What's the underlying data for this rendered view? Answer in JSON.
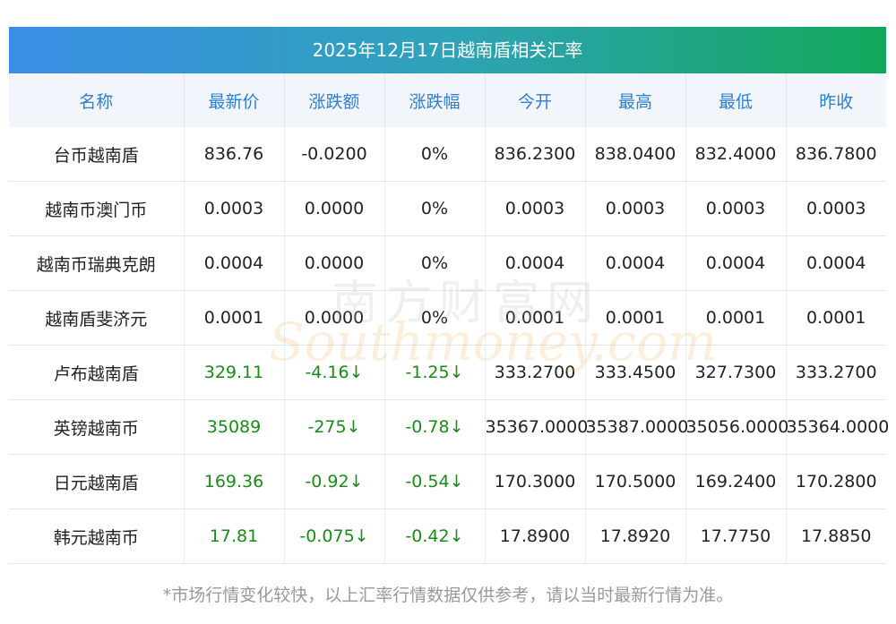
{
  "title": "2025年12月17日越南盾相关汇率",
  "columns": [
    "名称",
    "最新价",
    "涨跌额",
    "涨跌幅",
    "今开",
    "最高",
    "最低",
    "昨收"
  ],
  "rows": [
    {
      "name": "台币越南盾",
      "latest": "836.76",
      "change": "-0.0200",
      "pct": "0%",
      "open": "836.2300",
      "high": "838.0400",
      "low": "832.4000",
      "prev": "836.7800",
      "trend": "flat"
    },
    {
      "name": "越南币澳门币",
      "latest": "0.0003",
      "change": "0.0000",
      "pct": "0%",
      "open": "0.0003",
      "high": "0.0003",
      "low": "0.0003",
      "prev": "0.0003",
      "trend": "flat"
    },
    {
      "name": "越南币瑞典克朗",
      "latest": "0.0004",
      "change": "0.0000",
      "pct": "0%",
      "open": "0.0004",
      "high": "0.0004",
      "low": "0.0004",
      "prev": "0.0004",
      "trend": "flat"
    },
    {
      "name": "越南盾斐济元",
      "latest": "0.0001",
      "change": "0.0000",
      "pct": "0%",
      "open": "0.0001",
      "high": "0.0001",
      "low": "0.0001",
      "prev": "0.0001",
      "trend": "flat"
    },
    {
      "name": "卢布越南盾",
      "latest": "329.11",
      "change": "-4.16↓",
      "pct": "-1.25↓",
      "open": "333.2700",
      "high": "333.4500",
      "low": "327.7300",
      "prev": "333.2700",
      "trend": "down"
    },
    {
      "name": "英镑越南币",
      "latest": "35089",
      "change": "-275↓",
      "pct": "-0.78↓",
      "open": "35367.0000",
      "high": "35387.0000",
      "low": "35056.0000",
      "prev": "35364.0000",
      "trend": "down"
    },
    {
      "name": "日元越南盾",
      "latest": "169.36",
      "change": "-0.92↓",
      "pct": "-0.54↓",
      "open": "170.3000",
      "high": "170.5000",
      "low": "169.2400",
      "prev": "170.2800",
      "trend": "down"
    },
    {
      "name": "韩元越南币",
      "latest": "17.81",
      "change": "-0.075↓",
      "pct": "-0.42↓",
      "open": "17.8900",
      "high": "17.8920",
      "low": "17.7750",
      "prev": "17.8850",
      "trend": "down"
    }
  ],
  "footnote": "*市场行情变化较快，以上汇率行情数据仅供参考，请以当时最新行情为准。",
  "watermark": {
    "cn": "南方财富网",
    "en": "Southmoney.com"
  },
  "colors": {
    "header_text": "#2e7fd0",
    "down": "#1a8a1a",
    "title_start": "#3a8ee6",
    "title_end": "#12a85a"
  }
}
